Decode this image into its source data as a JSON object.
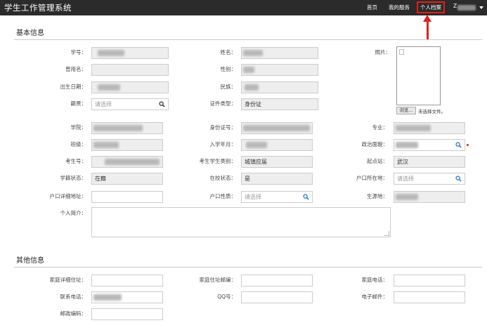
{
  "header": {
    "title": "学生工作管理系统",
    "nav": [
      "首页",
      "我的服务",
      "个人档案"
    ],
    "user_initial": "Z"
  },
  "sections": {
    "basic": "基本信息",
    "other": "其他信息"
  },
  "labels": {
    "student_id": "学号：",
    "name": "姓名：",
    "photo": "照片：",
    "former_name": "曾用名：",
    "gender": "性别：",
    "birth_date": "出生日期：",
    "ethnicity": "民族：",
    "native_place": "籍贯：",
    "id_type": "证件类型：",
    "college": "学院：",
    "id_number": "身份证号：",
    "major": "专业：",
    "class": "班级：",
    "enroll_year": "入学年月：",
    "political_status": "政治面貌：",
    "exam_number": "考生号：",
    "candidate_type": "考生学生类别：",
    "origin_station": "起点站：",
    "status": "学籍状态：",
    "on_campus": "在校状态：",
    "hukou_location": "户口所在地：",
    "hukou_address": "户口详细地址：",
    "hukou_nature": "户口性质：",
    "source_region": "生源地：",
    "bio": "个人简介：",
    "home_address": "家庭详细住址：",
    "home_postcode": "家庭住址邮编：",
    "home_phone": "家庭电话：",
    "phone": "联系电话：",
    "qq": "QQ号：",
    "email": "电子邮件：",
    "postcode": "邮政编码："
  },
  "values": {
    "id_type": "身份证",
    "candidate_type": "城镇应届",
    "origin_station": "武汉",
    "status": "在籍",
    "on_campus": "是"
  },
  "placeholders": {
    "select": "请选择"
  },
  "file_input": {
    "button": "浏览...",
    "no_file": "未选择文件。"
  },
  "colors": {
    "topbar": "#2b2b2b",
    "highlight": "#e0201a",
    "search_icon": "#2a7ad0"
  },
  "icons": {
    "search": "search-icon",
    "dropdown": "chevron-down-icon"
  }
}
